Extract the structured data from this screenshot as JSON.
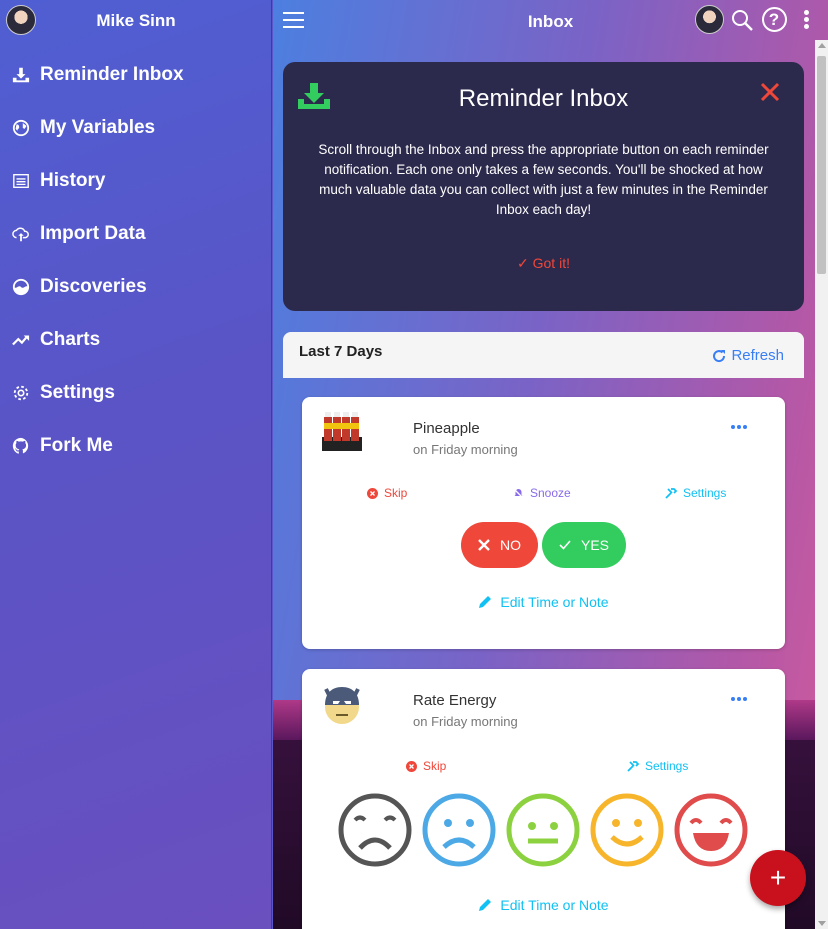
{
  "sidebar": {
    "user_name": "Mike Sinn",
    "items": [
      {
        "label": "Reminder Inbox",
        "icon": "download-icon"
      },
      {
        "label": "My Variables",
        "icon": "globe-icon"
      },
      {
        "label": "History",
        "icon": "list-icon"
      },
      {
        "label": "Import Data",
        "icon": "cloud-upload-icon"
      },
      {
        "label": "Discoveries",
        "icon": "contrast-icon"
      },
      {
        "label": "Charts",
        "icon": "trending-up-icon"
      },
      {
        "label": "Settings",
        "icon": "gear-icon"
      },
      {
        "label": "Fork Me",
        "icon": "github-icon"
      }
    ]
  },
  "topbar": {
    "title": "Inbox"
  },
  "help_card": {
    "title": "Reminder Inbox",
    "text": "Scroll through the Inbox and press the appropriate button on each reminder notification. Each one only takes a few seconds. You'll be shocked at how much valuable data you can collect with just a few minutes in the Reminder Inbox each day!",
    "got_it": "Got it!"
  },
  "list": {
    "header": "Last 7 Days",
    "refresh": "Refresh"
  },
  "reminders": [
    {
      "name": "Pineapple",
      "time": "on Friday morning",
      "skip": "Skip",
      "snooze": "Snooze",
      "settings": "Settings",
      "no": "NO",
      "yes": "YES",
      "edit": "Edit Time or Note"
    },
    {
      "name": "Rate Energy",
      "time": "on Friday morning",
      "skip": "Skip",
      "settings": "Settings",
      "edit": "Edit Time or Note"
    }
  ],
  "colors": {
    "assertive": "#ef473a",
    "balanced": "#33cd5f",
    "positive": "#387ef5",
    "calm": "#11c1f3",
    "royal": "#886aea",
    "fab": "#c9111e"
  }
}
